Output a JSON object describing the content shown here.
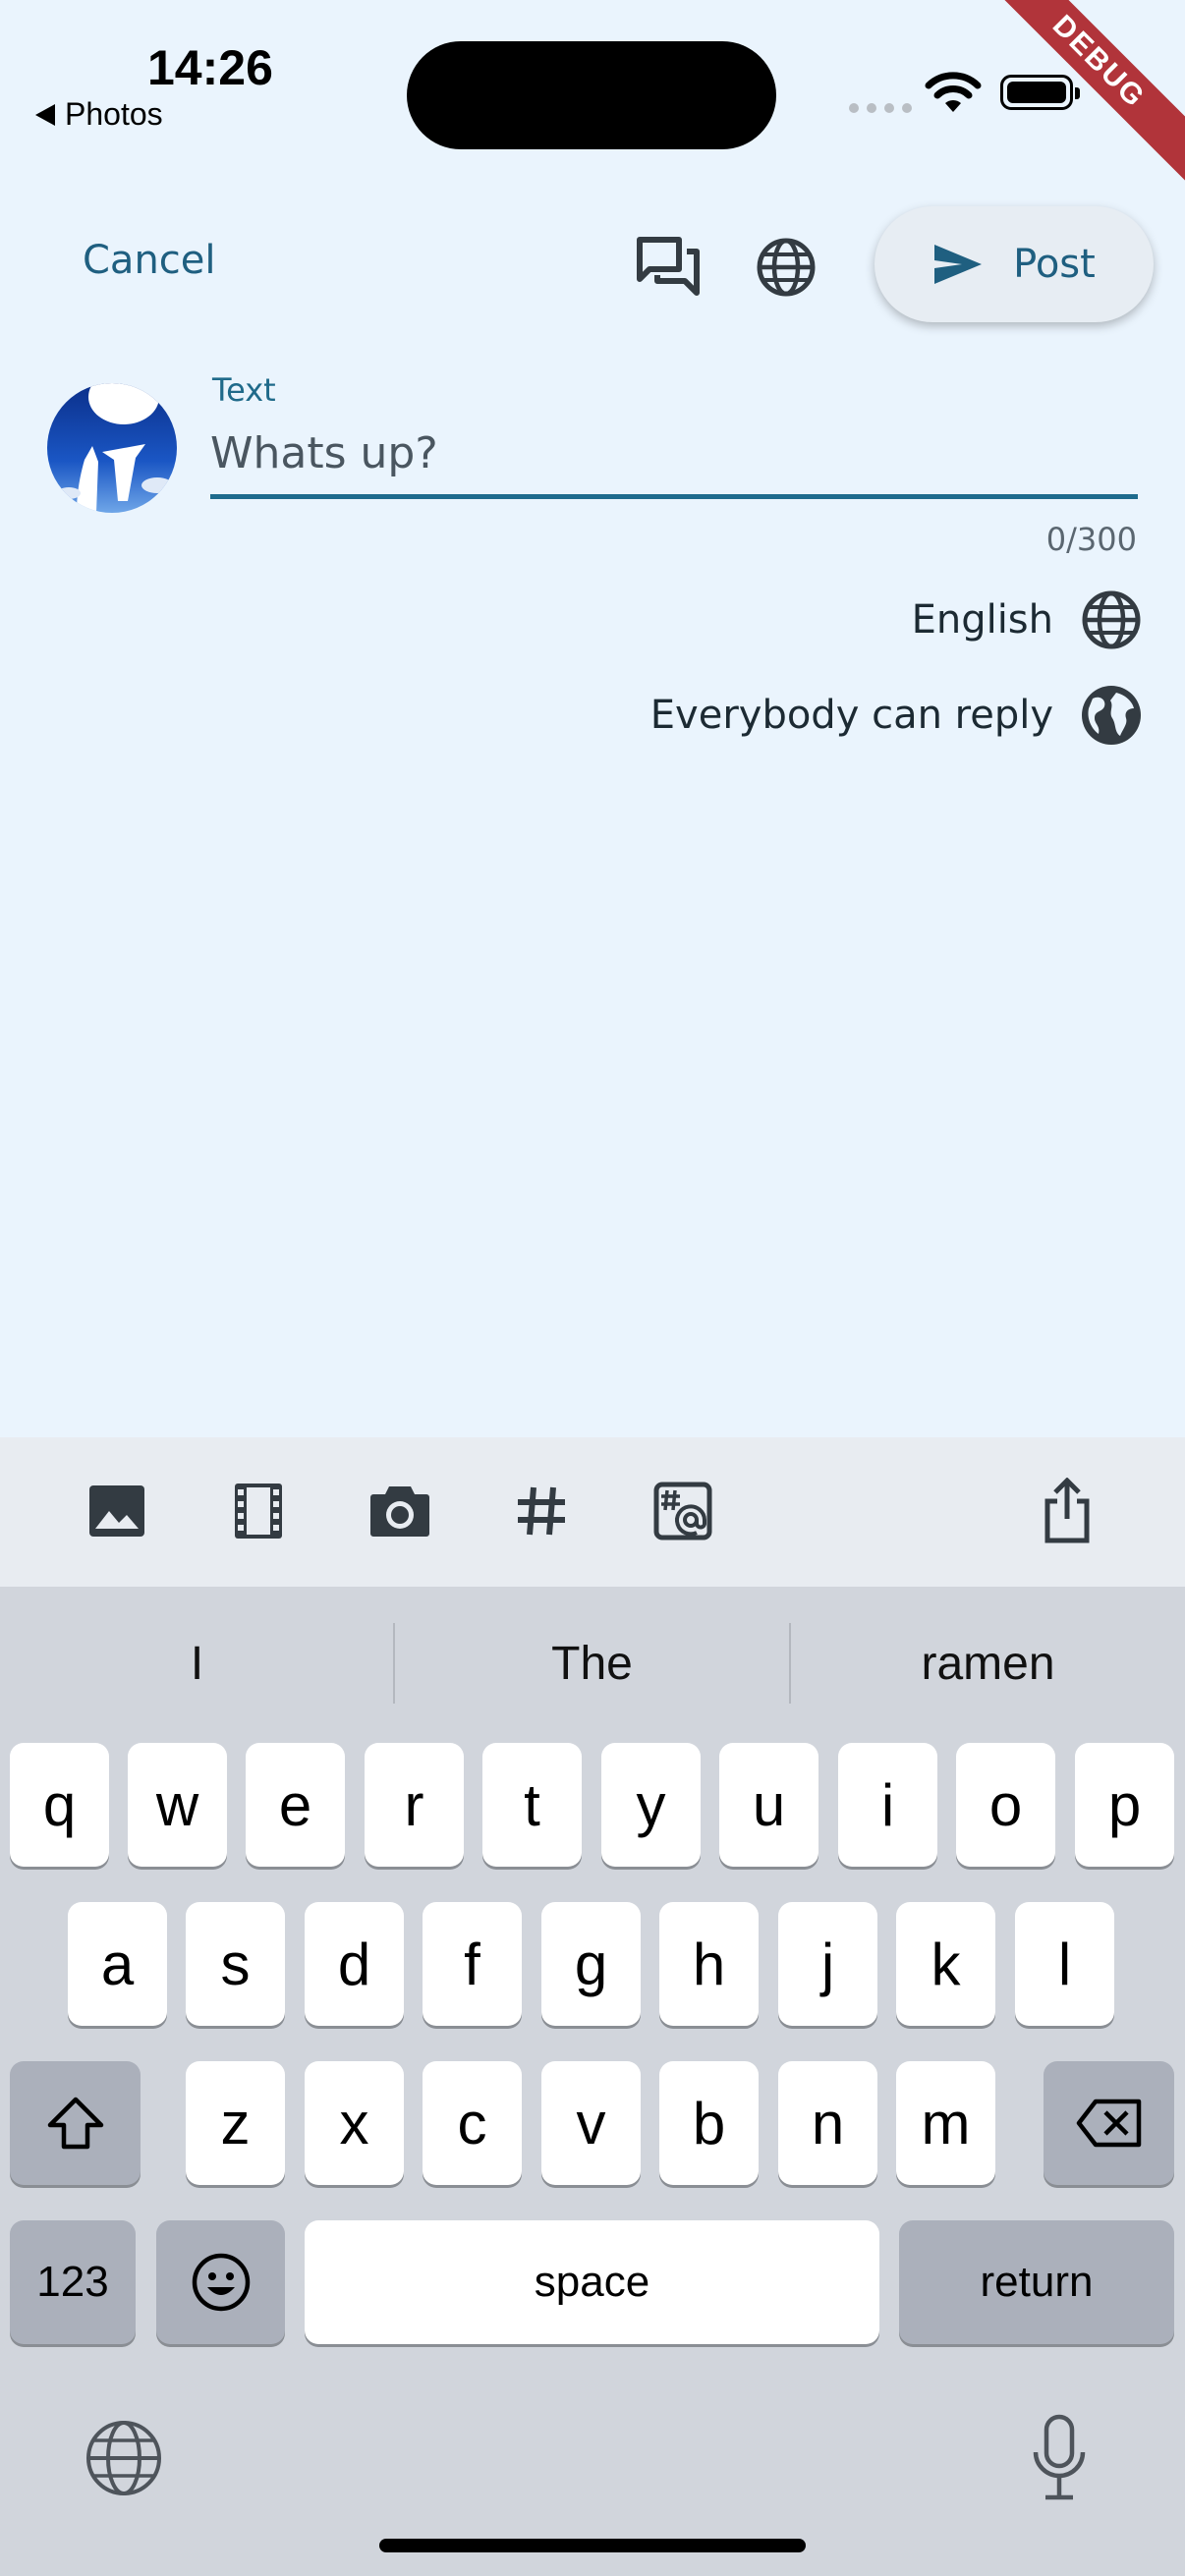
{
  "status_bar": {
    "time": "14:26",
    "back_label": "Photos",
    "debug_banner": "DEBUG"
  },
  "toolbar": {
    "cancel_label": "Cancel",
    "post_label": "Post"
  },
  "compose": {
    "field_label": "Text",
    "placeholder": "Whats up?",
    "value": "",
    "counter": "0/300"
  },
  "options": {
    "language": "English",
    "reply_setting": "Everybody can reply"
  },
  "keyboard": {
    "suggestions": [
      "I",
      "The",
      "ramen"
    ],
    "row1": [
      "q",
      "w",
      "e",
      "r",
      "t",
      "y",
      "u",
      "i",
      "o",
      "p"
    ],
    "row2": [
      "a",
      "s",
      "d",
      "f",
      "g",
      "h",
      "j",
      "k",
      "l"
    ],
    "row3": [
      "z",
      "x",
      "c",
      "v",
      "b",
      "n",
      "m"
    ],
    "numbers_label": "123",
    "space_label": "space",
    "return_label": "return"
  },
  "colors": {
    "background": "#eaf4fd",
    "accent": "#1f5f80",
    "keyboard_bg": "#d1d5dc",
    "debug_ribbon": "#b1343a"
  }
}
